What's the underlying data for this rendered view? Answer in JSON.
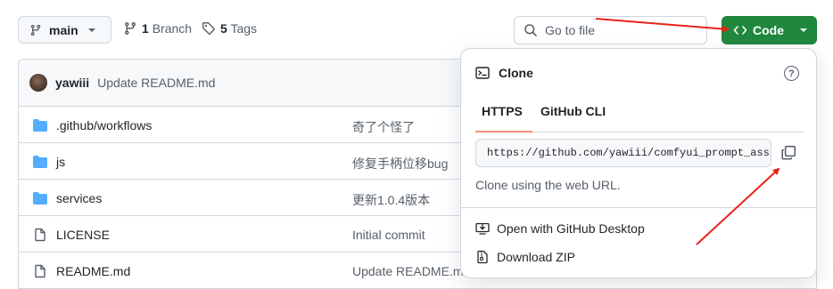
{
  "branch": {
    "name": "main"
  },
  "repo_meta": {
    "branch_count": "1",
    "branch_label": "Branch",
    "tag_count": "5",
    "tag_label": "Tags"
  },
  "search": {
    "placeholder": "Go to file"
  },
  "code_button": {
    "label": "Code"
  },
  "latest_commit": {
    "author": "yawiii",
    "message": "Update README.md"
  },
  "files": [
    {
      "type": "folder",
      "name": ".github/workflows",
      "commit": "奇了个怪了"
    },
    {
      "type": "folder",
      "name": "js",
      "commit": "修复手柄位移bug"
    },
    {
      "type": "folder",
      "name": "services",
      "commit": "更新1.0.4版本"
    },
    {
      "type": "file",
      "name": "LICENSE",
      "commit": "Initial commit"
    },
    {
      "type": "file",
      "name": "README.md",
      "commit": "Update README.md"
    }
  ],
  "clone": {
    "title": "Clone",
    "help": "?",
    "tabs": [
      "HTTPS",
      "GitHub CLI"
    ],
    "active_tab": "HTTPS",
    "url": "https://github.com/yawiii/comfyui_prompt_assistant.git",
    "hint": "Clone using the web URL.",
    "menu": [
      "Open with GitHub Desktop",
      "Download ZIP"
    ]
  },
  "colors": {
    "primary_green": "#1f883d",
    "accent_tab": "#fd8c73",
    "folder_blue": "#54aeff",
    "arrow_red": "#e8231a"
  },
  "icons": {
    "branch": "git-branch-icon",
    "tag": "tag-icon",
    "search": "search-icon",
    "code": "code-icon",
    "terminal": "terminal-icon",
    "copy": "copy-icon",
    "desktop": "desktop-download-icon",
    "zip": "file-zip-icon"
  }
}
